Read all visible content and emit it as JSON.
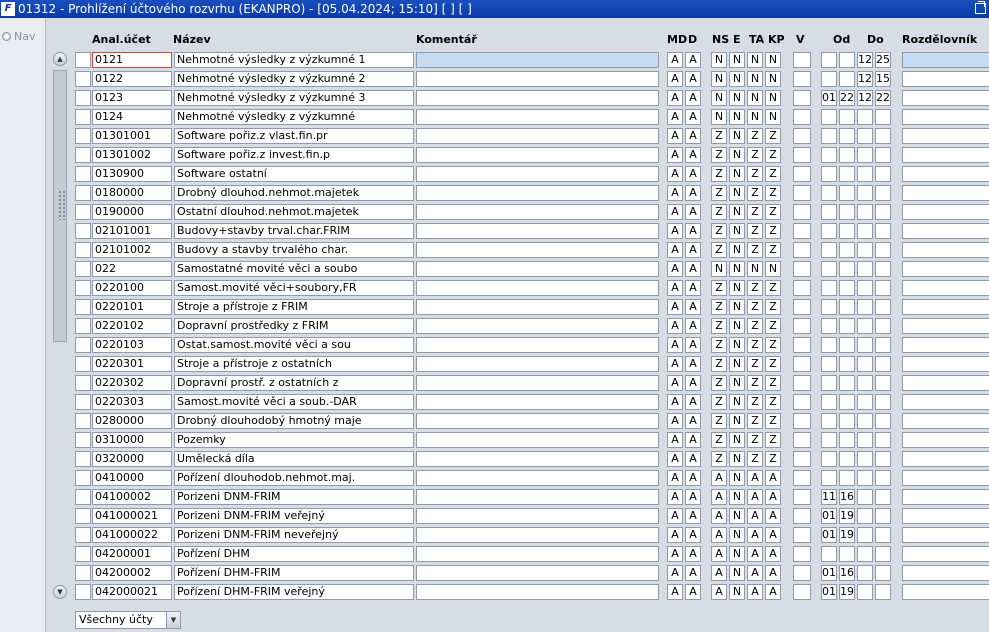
{
  "window": {
    "title": "01312 - Prohlížení účtového rozvrhu (EKANPRO) - [05.04.2024; 15:10]  [ ]  [ ]",
    "app_icon_text": "F"
  },
  "left_pane": {
    "nav_label": "Nav"
  },
  "columns": {
    "anal": "Anal.účet",
    "nazev": "Název",
    "komentar": "Komentář",
    "md": "MD",
    "d": "D",
    "ns": "NS",
    "e": "E",
    "ta": "TA",
    "kp": "KP",
    "v": "V",
    "od": "Od",
    "do": "Do",
    "rozdelovnik": "Rozdělovník"
  },
  "scroll": {
    "up_glyph": "▲",
    "down_glyph": "▼"
  },
  "rows": [
    {
      "anal": "0121",
      "nazev": "Nehmotné výsledky z výzkumné 1",
      "komentar": "",
      "md": "A",
      "d": "A",
      "ns": "N",
      "e": "N",
      "ta": "N",
      "kp": "N",
      "v": "",
      "od1": "",
      "od2": "",
      "do1": "12",
      "do2": "25",
      "rozd": ""
    },
    {
      "anal": "0122",
      "nazev": "Nehmotné výsledky z výzkumné 2",
      "komentar": "",
      "md": "A",
      "d": "A",
      "ns": "N",
      "e": "N",
      "ta": "N",
      "kp": "N",
      "v": "",
      "od1": "",
      "od2": "",
      "do1": "12",
      "do2": "15",
      "rozd": ""
    },
    {
      "anal": "0123",
      "nazev": "Nehmotné výsledky z výzkumné 3",
      "komentar": "",
      "md": "A",
      "d": "A",
      "ns": "N",
      "e": "N",
      "ta": "N",
      "kp": "N",
      "v": "",
      "od1": "01",
      "od2": "22",
      "do1": "12",
      "do2": "22",
      "rozd": ""
    },
    {
      "anal": "0124",
      "nazev": "Nehmotné výsledky z výzkumné",
      "komentar": "",
      "md": "A",
      "d": "A",
      "ns": "N",
      "e": "N",
      "ta": "N",
      "kp": "N",
      "v": "",
      "od1": "",
      "od2": "",
      "do1": "",
      "do2": "",
      "rozd": ""
    },
    {
      "anal": "01301001",
      "nazev": "Software pořiz.z vlast.fin.pr",
      "komentar": "",
      "md": "A",
      "d": "A",
      "ns": "Z",
      "e": "N",
      "ta": "Z",
      "kp": "Z",
      "v": "",
      "od1": "",
      "od2": "",
      "do1": "",
      "do2": "",
      "rozd": ""
    },
    {
      "anal": "01301002",
      "nazev": "Software pořiz.z invest.fin.p",
      "komentar": "",
      "md": "A",
      "d": "A",
      "ns": "Z",
      "e": "N",
      "ta": "Z",
      "kp": "Z",
      "v": "",
      "od1": "",
      "od2": "",
      "do1": "",
      "do2": "",
      "rozd": ""
    },
    {
      "anal": "0130900",
      "nazev": "Software ostatní",
      "komentar": "",
      "md": "A",
      "d": "A",
      "ns": "Z",
      "e": "N",
      "ta": "Z",
      "kp": "Z",
      "v": "",
      "od1": "",
      "od2": "",
      "do1": "",
      "do2": "",
      "rozd": ""
    },
    {
      "anal": "0180000",
      "nazev": "Drobný dlouhod.nehmot.majetek",
      "komentar": "",
      "md": "A",
      "d": "A",
      "ns": "Z",
      "e": "N",
      "ta": "Z",
      "kp": "Z",
      "v": "",
      "od1": "",
      "od2": "",
      "do1": "",
      "do2": "",
      "rozd": ""
    },
    {
      "anal": "0190000",
      "nazev": "Ostatní dlouhod.nehmot.majetek",
      "komentar": "",
      "md": "A",
      "d": "A",
      "ns": "Z",
      "e": "N",
      "ta": "Z",
      "kp": "Z",
      "v": "",
      "od1": "",
      "od2": "",
      "do1": "",
      "do2": "",
      "rozd": ""
    },
    {
      "anal": "02101001",
      "nazev": "Budovy+stavby trval.char.FRIM",
      "komentar": "",
      "md": "A",
      "d": "A",
      "ns": "Z",
      "e": "N",
      "ta": "Z",
      "kp": "Z",
      "v": "",
      "od1": "",
      "od2": "",
      "do1": "",
      "do2": "",
      "rozd": ""
    },
    {
      "anal": "02101002",
      "nazev": "Budovy a stavby trvalého char.",
      "komentar": "",
      "md": "A",
      "d": "A",
      "ns": "Z",
      "e": "N",
      "ta": "Z",
      "kp": "Z",
      "v": "",
      "od1": "",
      "od2": "",
      "do1": "",
      "do2": "",
      "rozd": ""
    },
    {
      "anal": "022",
      "nazev": "Samostatné movité věci a soubo",
      "komentar": "",
      "md": "A",
      "d": "A",
      "ns": "N",
      "e": "N",
      "ta": "N",
      "kp": "N",
      "v": "",
      "od1": "",
      "od2": "",
      "do1": "",
      "do2": "",
      "rozd": ""
    },
    {
      "anal": "0220100",
      "nazev": "Samost.movité věci+soubory,FR",
      "komentar": "",
      "md": "A",
      "d": "A",
      "ns": "Z",
      "e": "N",
      "ta": "Z",
      "kp": "Z",
      "v": "",
      "od1": "",
      "od2": "",
      "do1": "",
      "do2": "",
      "rozd": ""
    },
    {
      "anal": "0220101",
      "nazev": "Stroje a přístroje z FRIM",
      "komentar": "",
      "md": "A",
      "d": "A",
      "ns": "Z",
      "e": "N",
      "ta": "Z",
      "kp": "Z",
      "v": "",
      "od1": "",
      "od2": "",
      "do1": "",
      "do2": "",
      "rozd": ""
    },
    {
      "anal": "0220102",
      "nazev": "Dopravní prostředky z FRIM",
      "komentar": "",
      "md": "A",
      "d": "A",
      "ns": "Z",
      "e": "N",
      "ta": "Z",
      "kp": "Z",
      "v": "",
      "od1": "",
      "od2": "",
      "do1": "",
      "do2": "",
      "rozd": ""
    },
    {
      "anal": "0220103",
      "nazev": "Ostat.samost.movité věci a sou",
      "komentar": "",
      "md": "A",
      "d": "A",
      "ns": "Z",
      "e": "N",
      "ta": "Z",
      "kp": "Z",
      "v": "",
      "od1": "",
      "od2": "",
      "do1": "",
      "do2": "",
      "rozd": ""
    },
    {
      "anal": "0220301",
      "nazev": "Stroje a přístroje z ostatních",
      "komentar": "",
      "md": "A",
      "d": "A",
      "ns": "Z",
      "e": "N",
      "ta": "Z",
      "kp": "Z",
      "v": "",
      "od1": "",
      "od2": "",
      "do1": "",
      "do2": "",
      "rozd": ""
    },
    {
      "anal": "0220302",
      "nazev": "Dopravní prostř. z ostatních z",
      "komentar": "",
      "md": "A",
      "d": "A",
      "ns": "Z",
      "e": "N",
      "ta": "Z",
      "kp": "Z",
      "v": "",
      "od1": "",
      "od2": "",
      "do1": "",
      "do2": "",
      "rozd": ""
    },
    {
      "anal": "0220303",
      "nazev": "Samost.movité věci a soub.-DAR",
      "komentar": "",
      "md": "A",
      "d": "A",
      "ns": "Z",
      "e": "N",
      "ta": "Z",
      "kp": "Z",
      "v": "",
      "od1": "",
      "od2": "",
      "do1": "",
      "do2": "",
      "rozd": ""
    },
    {
      "anal": "0280000",
      "nazev": "Drobný dlouhodobý hmotný  maje",
      "komentar": "",
      "md": "A",
      "d": "A",
      "ns": "Z",
      "e": "N",
      "ta": "Z",
      "kp": "Z",
      "v": "",
      "od1": "",
      "od2": "",
      "do1": "",
      "do2": "",
      "rozd": ""
    },
    {
      "anal": "0310000",
      "nazev": "Pozemky",
      "komentar": "",
      "md": "A",
      "d": "A",
      "ns": "Z",
      "e": "N",
      "ta": "Z",
      "kp": "Z",
      "v": "",
      "od1": "",
      "od2": "",
      "do1": "",
      "do2": "",
      "rozd": ""
    },
    {
      "anal": "0320000",
      "nazev": "Umělecká díla",
      "komentar": "",
      "md": "A",
      "d": "A",
      "ns": "Z",
      "e": "N",
      "ta": "Z",
      "kp": "Z",
      "v": "",
      "od1": "",
      "od2": "",
      "do1": "",
      "do2": "",
      "rozd": ""
    },
    {
      "anal": "0410000",
      "nazev": "Pořízení dlouhodob.nehmot.maj.",
      "komentar": "",
      "md": "A",
      "d": "A",
      "ns": "A",
      "e": "N",
      "ta": "A",
      "kp": "A",
      "v": "",
      "od1": "",
      "od2": "",
      "do1": "",
      "do2": "",
      "rozd": ""
    },
    {
      "anal": "04100002",
      "nazev": "Porizeni DNM-FRIM",
      "komentar": "",
      "md": "A",
      "d": "A",
      "ns": "A",
      "e": "N",
      "ta": "A",
      "kp": "A",
      "v": "",
      "od1": "11",
      "od2": "16",
      "do1": "",
      "do2": "",
      "rozd": ""
    },
    {
      "anal": "041000021",
      "nazev": "Porizeni DNM-FRIM veřejný",
      "komentar": "",
      "md": "A",
      "d": "A",
      "ns": "A",
      "e": "N",
      "ta": "A",
      "kp": "A",
      "v": "",
      "od1": "01",
      "od2": "19",
      "do1": "",
      "do2": "",
      "rozd": ""
    },
    {
      "anal": "041000022",
      "nazev": "Porizeni DNM-FRIM neveřejný",
      "komentar": "",
      "md": "A",
      "d": "A",
      "ns": "A",
      "e": "N",
      "ta": "A",
      "kp": "A",
      "v": "",
      "od1": "01",
      "od2": "19",
      "do1": "",
      "do2": "",
      "rozd": ""
    },
    {
      "anal": "04200001",
      "nazev": "Pořízení DHM",
      "komentar": "",
      "md": "A",
      "d": "A",
      "ns": "A",
      "e": "N",
      "ta": "A",
      "kp": "A",
      "v": "",
      "od1": "",
      "od2": "",
      "do1": "",
      "do2": "",
      "rozd": ""
    },
    {
      "anal": "04200002",
      "nazev": "Pořízení DHM-FRIM",
      "komentar": "",
      "md": "A",
      "d": "A",
      "ns": "A",
      "e": "N",
      "ta": "A",
      "kp": "A",
      "v": "",
      "od1": "01",
      "od2": "16",
      "do1": "",
      "do2": "",
      "rozd": ""
    },
    {
      "anal": "042000021",
      "nazev": "Pořízení DHM-FRIM veřejný",
      "komentar": "",
      "md": "A",
      "d": "A",
      "ns": "A",
      "e": "N",
      "ta": "A",
      "kp": "A",
      "v": "",
      "od1": "01",
      "od2": "19",
      "do1": "",
      "do2": "",
      "rozd": ""
    }
  ],
  "filter": {
    "selected": "Všechny účty",
    "arrow_glyph": "▼"
  }
}
